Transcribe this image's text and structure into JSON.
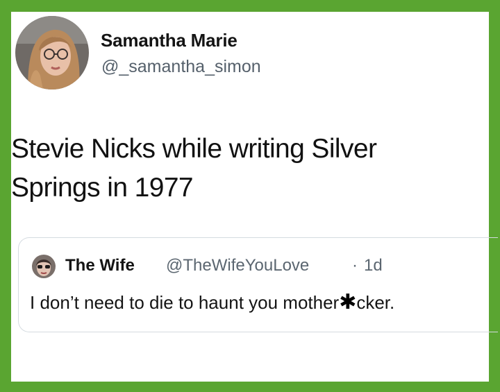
{
  "author": {
    "name": "Samantha Marie",
    "handle": "@_samantha_simon",
    "avatar_icon": "profile-photo"
  },
  "tweet": {
    "line1": "Stevie Nicks while writing Silver",
    "line2": "Springs in 1977"
  },
  "quoted": {
    "name": "The Wife",
    "handle": "@TheWifeYouLove",
    "separator": "·",
    "time": "1d",
    "text_before": "I don’t need to die to haunt you mother",
    "censor_glyph": "✱",
    "text_after": "cker."
  },
  "colors": {
    "border": "#5aa531",
    "background": "#ffffff",
    "secondary_text": "#55606b"
  }
}
